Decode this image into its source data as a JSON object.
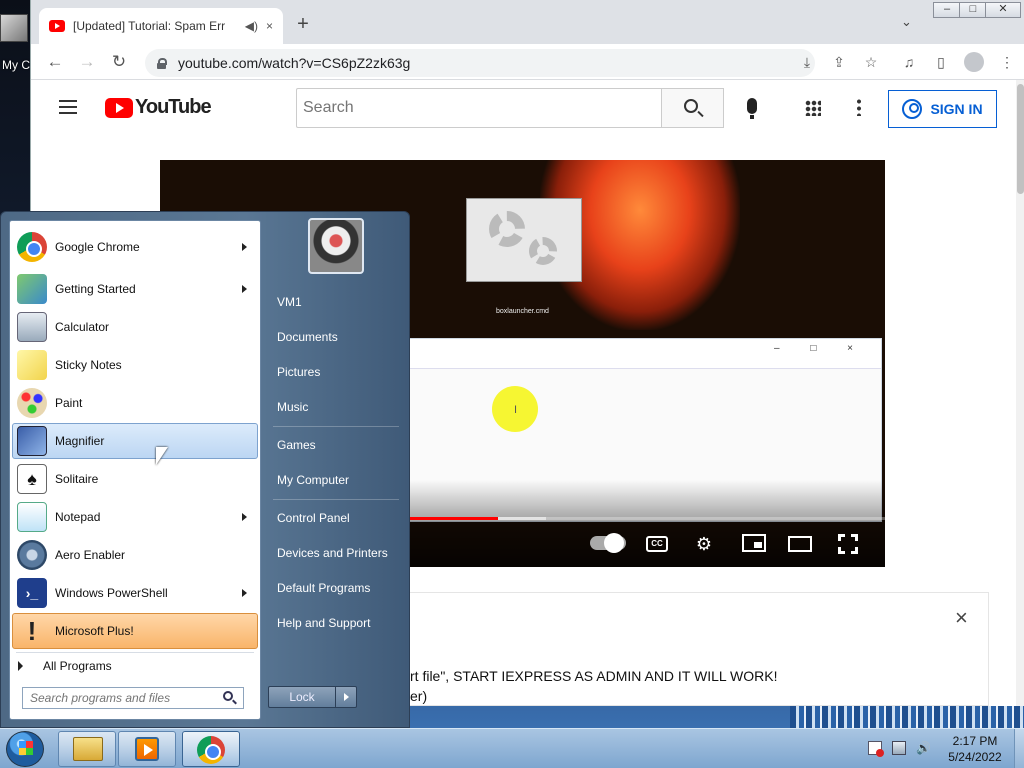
{
  "desktop": {
    "icon_label": "My C"
  },
  "browser": {
    "tab": {
      "title": "[Updated] Tutorial: Spam Err",
      "close_icon": "×",
      "audio_icon": "audio-icon"
    },
    "new_tab_icon": "+",
    "tab_search_icon": "chevron-down-icon",
    "window_controls": {
      "minimize": "–",
      "maximize": "□",
      "close": "✕"
    },
    "nav": {
      "back": "←",
      "forward": "→",
      "reload": "↻"
    },
    "url": "youtube.com/watch?v=CS6pZ2zk63g",
    "toolbar_icons": {
      "install": "⤓",
      "share": "⇪",
      "bookmark": "☆",
      "media": "♫",
      "sidepanel": "▯",
      "menu": "⋮"
    }
  },
  "youtube": {
    "logo_text": "YouTube",
    "search_placeholder": "Search",
    "signin_label": "SIGN IN",
    "video": {
      "inner_caption": "boxlauncher.cmd",
      "inner_window_buttons": "– □ ×",
      "text_cursor": "I",
      "progress_played": 0.466,
      "progress_buffered": 0.532,
      "cc_label": "CC"
    },
    "description": {
      "close_icon": "×",
      "line1": "rt file\", START IEXPRESS AS ADMIN AND IT WILL WORK!",
      "line2": "er)"
    }
  },
  "start_menu": {
    "left_items": [
      {
        "label": "Google Chrome",
        "has_arrow": true,
        "icon": "chrome-icon"
      },
      {
        "label": "Getting Started",
        "has_arrow": true,
        "icon": "getting-started-icon"
      },
      {
        "label": "Calculator",
        "has_arrow": false,
        "icon": "calculator-icon"
      },
      {
        "label": "Sticky Notes",
        "has_arrow": false,
        "icon": "sticky-notes-icon"
      },
      {
        "label": "Paint",
        "has_arrow": false,
        "icon": "paint-icon"
      },
      {
        "label": "Magnifier",
        "has_arrow": false,
        "icon": "magnifier-icon",
        "highlighted": true
      },
      {
        "label": "Solitaire",
        "has_arrow": false,
        "icon": "solitaire-icon"
      },
      {
        "label": "Notepad",
        "has_arrow": true,
        "icon": "notepad-icon"
      },
      {
        "label": "Aero Enabler",
        "has_arrow": false,
        "icon": "aero-enabler-icon"
      },
      {
        "label": "Windows PowerShell",
        "has_arrow": true,
        "icon": "powershell-icon"
      },
      {
        "label": "Microsoft Plus!",
        "has_arrow": false,
        "icon": "microsoft-plus-icon",
        "new": true
      }
    ],
    "all_programs": "All Programs",
    "search_placeholder": "Search programs and files",
    "right_items": [
      "VM1",
      "Documents",
      "Pictures",
      "Music",
      "Games",
      "My Computer",
      "Control Panel",
      "Devices and Printers",
      "Default Programs",
      "Help and Support"
    ],
    "lock_label": "Lock"
  },
  "taskbar": {
    "clock_time": "2:17 PM",
    "clock_date": "5/24/2022",
    "volume_icon": "🔊"
  },
  "colors": {
    "youtube_red": "#ff0000",
    "signin_blue": "#065fd4",
    "start_menu_blue": "#5a7794"
  }
}
